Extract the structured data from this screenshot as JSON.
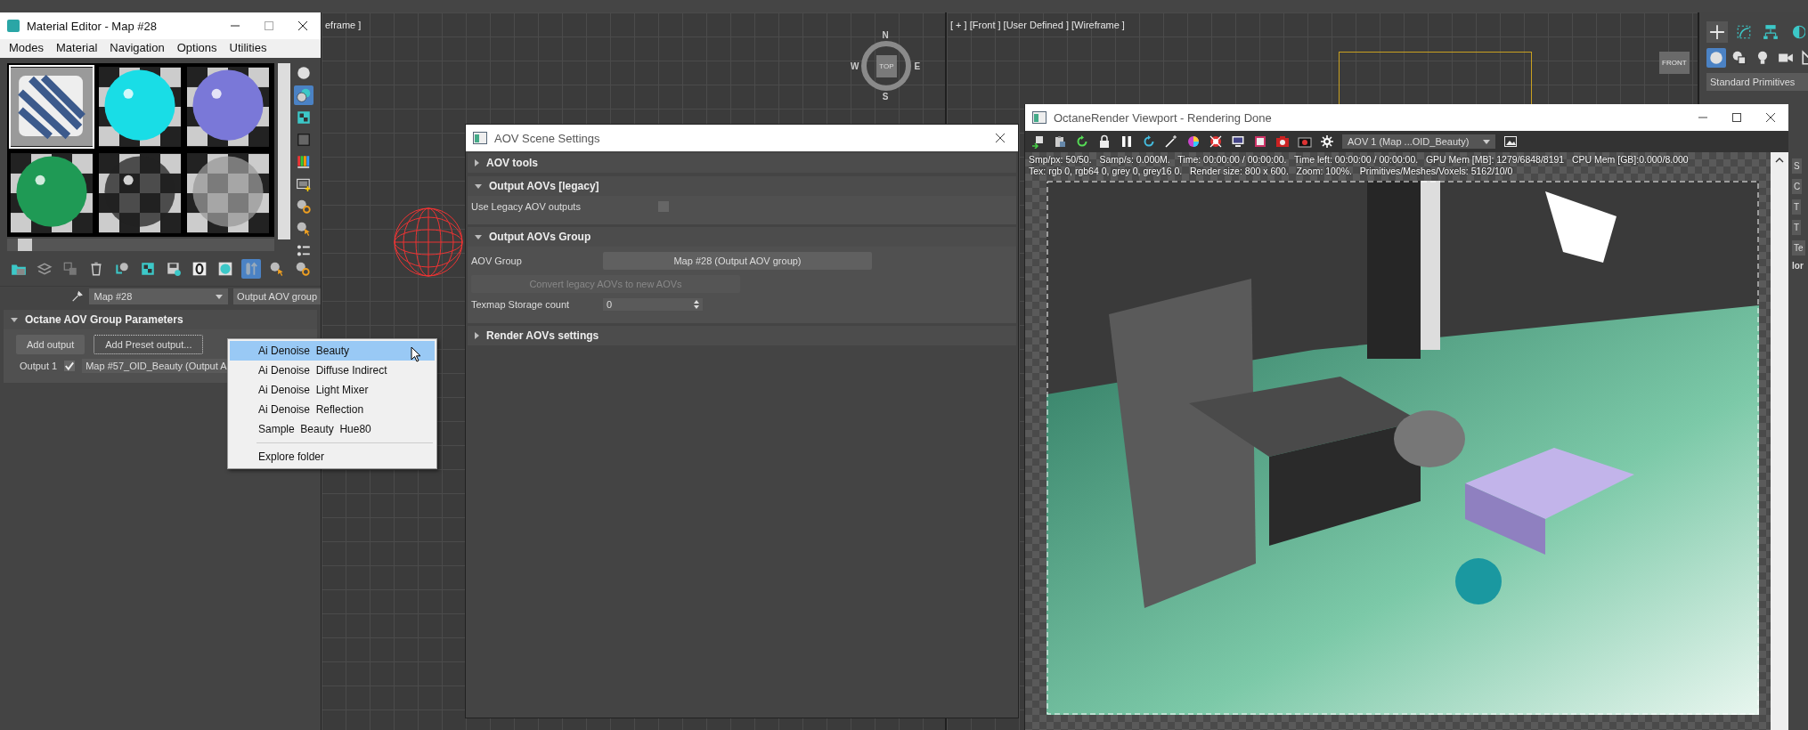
{
  "left_viewport": {
    "label": "eframe ]",
    "viewcube": {
      "face": "TOP",
      "north": "N",
      "west": "W",
      "east": "E",
      "south": "S"
    }
  },
  "right_viewport": {
    "label": "[ + ] [Front ] [User Defined ] [Wireframe ]",
    "viewcube": {
      "face": "FRONT"
    }
  },
  "command_panel": {
    "tabs": [
      {
        "kind": "plus",
        "selected": true
      },
      {
        "kind": "curve-box",
        "selected": false
      },
      {
        "kind": "hierarchy",
        "selected": false
      },
      {
        "kind": "half-disc",
        "selected": false
      }
    ],
    "object_types": [
      {
        "kind": "sphere",
        "selected": true
      },
      {
        "kind": "shapes",
        "selected": false
      },
      {
        "kind": "bulb",
        "selected": false
      },
      {
        "kind": "camera",
        "selected": false
      },
      {
        "kind": "set-square",
        "selected": false
      }
    ],
    "dropdown": "Standard Primitives",
    "side_buttons": [
      "S",
      "C",
      "T",
      "T",
      "Te"
    ],
    "side_label": "lor"
  },
  "material_editor": {
    "title": "Material Editor - Map #28",
    "menu": [
      "Modes",
      "Material",
      "Navigation",
      "Options",
      "Utilities"
    ],
    "slots": [
      {
        "kind": "striped-tile",
        "selected": true
      },
      {
        "kind": "sphere",
        "color": "#19dde6",
        "selected": false
      },
      {
        "kind": "sphere",
        "color": "#7a78d8",
        "selected": false
      },
      {
        "kind": "sphere",
        "color": "#1f9a55",
        "selected": false
      },
      {
        "kind": "chrome-sphere",
        "color": "#222222",
        "selected": false
      },
      {
        "kind": "frosted-sphere",
        "color": "#9a9a9a",
        "selected": false
      }
    ],
    "side_tools": [
      {
        "kind": "sphere",
        "on": false
      },
      {
        "kind": "two-spheres",
        "on": true
      },
      {
        "kind": "checker",
        "on": false
      },
      {
        "kind": "square",
        "on": false
      },
      {
        "kind": "color-bars",
        "on": false
      },
      {
        "kind": "film-frame",
        "on": false
      },
      {
        "kind": "checker-gear",
        "on": false
      },
      {
        "kind": "checker-pointer",
        "on": false
      },
      {
        "kind": "list",
        "on": false
      }
    ],
    "toolbar": [
      {
        "kind": "folder",
        "on": false
      },
      {
        "kind": "layers",
        "on": false
      },
      {
        "kind": "copy",
        "on": false
      },
      {
        "kind": "trash",
        "on": false
      },
      {
        "kind": "checker-arrow",
        "on": false
      },
      {
        "kind": "checker",
        "on": false
      },
      {
        "kind": "disk",
        "on": false
      },
      {
        "kind": "zero-box",
        "on": false
      },
      {
        "kind": "checker-circle",
        "on": false
      },
      {
        "kind": "tube-arrow",
        "on": true
      },
      {
        "kind": "checker-pointer",
        "on": false
      },
      {
        "kind": "checker-gear",
        "on": false
      }
    ],
    "map_name": "Map #28",
    "type_button": "Output AOV group",
    "rollout": {
      "title": "Octane AOV Group Parameters",
      "expanded": true,
      "add_output": "Add output",
      "add_preset": "Add Preset output...",
      "outputs": [
        {
          "label": "Output 1",
          "checked": true,
          "map": "Map #57_OID_Beauty (Output A"
        }
      ]
    }
  },
  "context_menu": {
    "items": [
      {
        "label": "Ai Denoise  Beauty",
        "selected": true
      },
      {
        "label": "Ai Denoise  Diffuse Indirect",
        "selected": false
      },
      {
        "label": "Ai Denoise  Light Mixer",
        "selected": false
      },
      {
        "label": "Ai Denoise  Reflection",
        "selected": false
      },
      {
        "label": "Sample  Beauty  Hue80",
        "selected": false
      }
    ],
    "footer_items": [
      {
        "label": "Explore folder",
        "selected": false
      }
    ]
  },
  "aov_dialog": {
    "title": "AOV Scene Settings",
    "rollouts": [
      {
        "kind": "plain",
        "title": "AOV tools",
        "expanded": false
      },
      {
        "kind": "legacy",
        "title": "Output AOVs [legacy]",
        "expanded": true,
        "checkbox_label": "Use Legacy AOV outputs",
        "checked": false
      },
      {
        "kind": "group",
        "title": "Output AOVs Group",
        "expanded": true,
        "group_label": "AOV Group",
        "group_button": "Map #28 (Output AOV group)",
        "convert_button": "Convert legacy AOVs to new AOVs",
        "convert_disabled": true,
        "count_label": "Texmap Storage count",
        "count_value": "0"
      },
      {
        "kind": "plain",
        "title": "Render AOVs settings",
        "expanded": false
      }
    ]
  },
  "octane_viewport": {
    "title": "OctaneRender Viewport - Rendering Done",
    "toolbar": [
      {
        "kind": "export-arrows"
      },
      {
        "kind": "clipboard"
      },
      {
        "kind": "reload"
      },
      {
        "kind": "lock"
      },
      {
        "kind": "pause"
      },
      {
        "kind": "refresh"
      },
      {
        "kind": "wand"
      },
      {
        "kind": "color-wheel"
      },
      {
        "kind": "target"
      },
      {
        "kind": "monitor"
      },
      {
        "kind": "picture-frame"
      },
      {
        "kind": "photo-camera"
      },
      {
        "kind": "film-camera"
      },
      {
        "kind": "gear"
      }
    ],
    "aov_dropdown": "AOV 1 (Map ...OID_Beauty)",
    "status_lines": [
      "Smp/px: 50/50.   Samp/s: 0.000M.   Time: 00:00:00 / 00:00:00.   Time left: 00:00:00 / 00:00:00.   GPU Mem [MB]: 1279/6848/8191   CPU Mem [GB]:0.000/8.000",
      "Tex: rgb 0, rgb64 0, grey 0, grey16 0.   Render size: 800 x 600.   Zoom: 100%.   Primitives/Meshes/Voxels: 5162/10/0"
    ]
  }
}
